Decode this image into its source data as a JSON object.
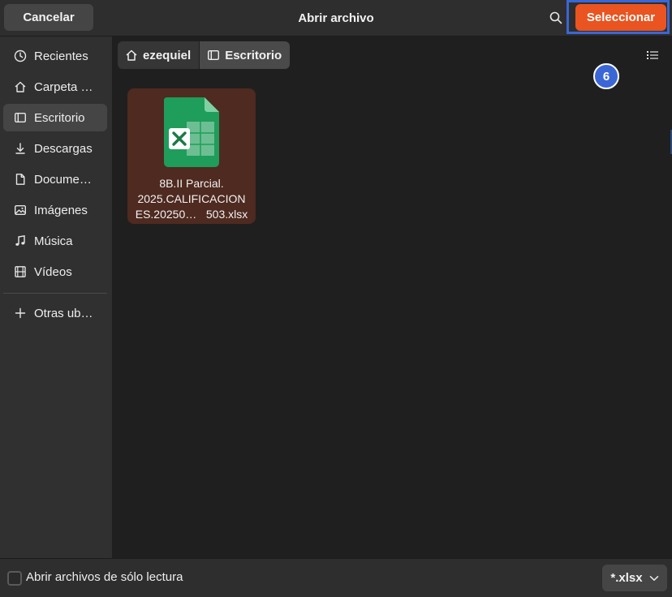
{
  "header": {
    "title": "Abrir archivo",
    "cancel_label": "Cancelar",
    "select_label": "Seleccionar",
    "search_icon": "search-icon"
  },
  "sidebar": {
    "items": [
      {
        "label": "Recientes",
        "icon": "clock-icon"
      },
      {
        "label": "Carpeta …",
        "icon": "home-icon"
      },
      {
        "label": "Escritorio",
        "icon": "desktop-icon",
        "active": true
      },
      {
        "label": "Descargas",
        "icon": "download-icon"
      },
      {
        "label": "Docume…",
        "icon": "document-icon"
      },
      {
        "label": "Imágenes",
        "icon": "image-icon"
      },
      {
        "label": "Música",
        "icon": "music-icon"
      },
      {
        "label": "Vídeos",
        "icon": "video-icon"
      },
      {
        "label": "Otras ub…",
        "icon": "plus-icon"
      }
    ]
  },
  "breadcrumb": {
    "home": "ezequiel",
    "current": "Escritorio"
  },
  "annotation": {
    "badge": "6"
  },
  "files": [
    {
      "name_lines": [
        "8B.II Parcial.",
        "2025.CALIFICACION",
        "ES.20250…   503.xlsx"
      ],
      "icon": "spreadsheet-icon",
      "selected": true
    }
  ],
  "footer": {
    "readonly_label": "Abrir archivos de sólo lectura",
    "readonly_checked": false,
    "filter_value": "*.xlsx"
  },
  "colors": {
    "accent": "#e95420",
    "highlight": "#3a66d6",
    "selected_tile": "#4e2a20"
  }
}
